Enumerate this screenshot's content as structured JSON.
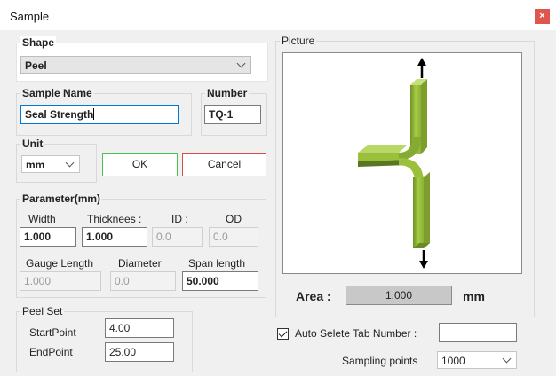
{
  "window": {
    "title": "Sample",
    "close_glyph": "×"
  },
  "shape": {
    "label": "Shape",
    "selected": "Peel"
  },
  "sample_name": {
    "label": "Sample Name",
    "value": "Seal Strength"
  },
  "number": {
    "label": "Number",
    "value": "TQ-1"
  },
  "unit": {
    "label": "Unit",
    "selected": "mm"
  },
  "buttons": {
    "ok": "OK",
    "cancel": "Cancel"
  },
  "parameter": {
    "label": "Parameter(mm)",
    "width_label": "Width",
    "width_value": "1.000",
    "thickness_label": "Thicknees :",
    "thickness_value": "1.000",
    "id_label": "ID :",
    "id_value": "0.0",
    "od_label": "OD",
    "od_value": "0.0",
    "gauge_label": "Gauge Length",
    "gauge_value": "1.000",
    "diameter_label": "Diameter",
    "diameter_value": "0.0",
    "span_label": "Span length",
    "span_value": "50.000"
  },
  "peel_set": {
    "label": "Peel Set",
    "start_label": "StartPoint",
    "start_value": "4.00",
    "end_label": "EndPoint",
    "end_value": "25.00"
  },
  "picture": {
    "label": "Picture",
    "icon": "peel-test-specimen-icon"
  },
  "area": {
    "label": "Area :",
    "value": "1.000",
    "unit": "mm"
  },
  "auto_select": {
    "label": "Auto Selete Tab Number :",
    "checked": true,
    "value": ""
  },
  "sampling": {
    "label": "Sampling points",
    "selected": "1000"
  },
  "colors": {
    "close": "#e0564f",
    "ok_border": "#4cc04c",
    "cancel_border": "#d94c4c",
    "focus": "#0078d7",
    "specimen": "#9bc13c"
  }
}
